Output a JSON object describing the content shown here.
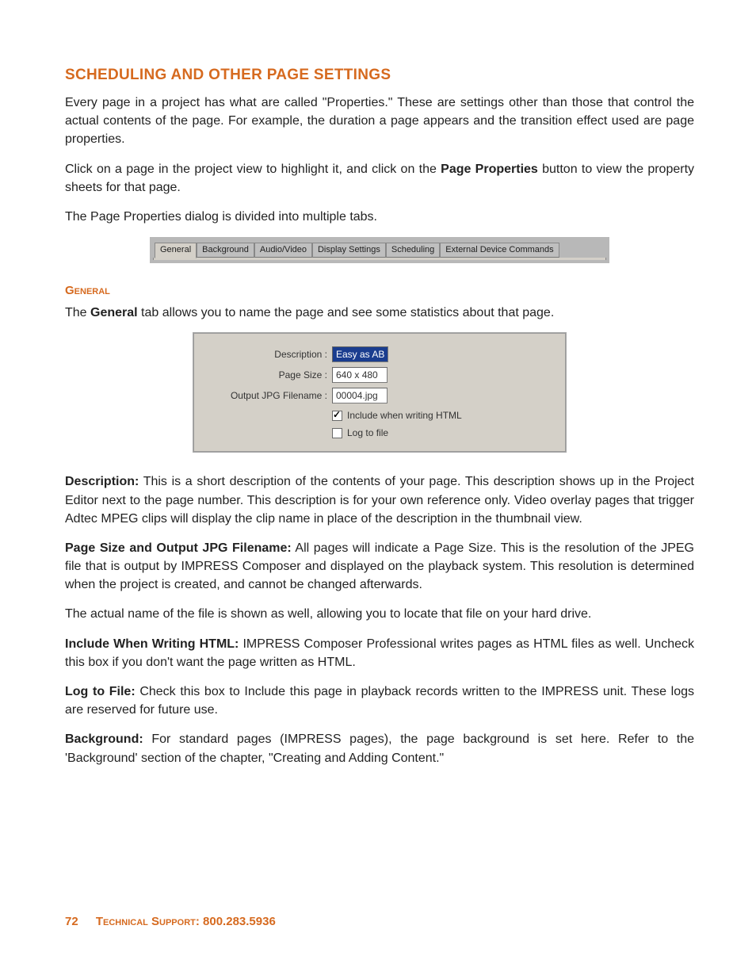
{
  "title": "SCHEDULING AND OTHER PAGE SETTINGS",
  "intro1_a": "Every page in a project has what are called \"Properties.\" These are settings other than those that control the actual contents of the page. For example, the duration a page appears and the transition effect used are page properties.",
  "intro2_a": "Click on a page in the project view to highlight it, and click on the ",
  "intro2_b": "Page Properties",
  "intro2_c": " button to view the property sheets for that page.",
  "intro3": "The Page Properties dialog is divided into multiple tabs.",
  "tabs": {
    "items": [
      {
        "label": "General",
        "active": true
      },
      {
        "label": "Background",
        "active": false
      },
      {
        "label": "Audio/Video",
        "active": false
      },
      {
        "label": "Display Settings",
        "active": false
      },
      {
        "label": "Scheduling",
        "active": false
      },
      {
        "label": "External Device Commands",
        "active": false
      }
    ]
  },
  "sub_general": "General",
  "general_intro_a": "The ",
  "general_intro_b": "General",
  "general_intro_c": " tab allows you to name the page and see some statistics about that page.",
  "panel": {
    "description_label": "Description :",
    "description_value": "Easy as AB",
    "pagesize_label": "Page Size :",
    "pagesize_value": "640 x 480",
    "jpg_label": "Output JPG Filename :",
    "jpg_value": "00004.jpg",
    "chk1_label": "Include when writing HTML",
    "chk1_checked": true,
    "chk2_label": "Log to file",
    "chk2_checked": false
  },
  "defs": {
    "description_h": "Description:",
    "description_t": " This is a short description of the contents of your page. This description shows up in the Project Editor next to the page number. This description is for your own reference only. Video overlay pages that trigger Adtec MPEG clips will display the clip name in place of the description in the thumbnail view.",
    "pagesize_h": "Page Size and Output JPG Filename:",
    "pagesize_t": " All pages will indicate a Page Size. This is the resolution of the JPEG file that is output by IMPRESS Composer and displayed on the playback system. This resolution is determined when the project is created, and cannot be changed afterwards.",
    "actualname": "The actual name of the file is shown as well, allowing you to locate that file on your hard drive.",
    "includehtml_h": "Include When Writing HTML:",
    "includehtml_t": " IMPRESS Composer Professional writes pages as HTML files as well. Uncheck this box if you don't want the page written as HTML.",
    "logfile_h": "Log to File:",
    "logfile_t": " Check this box to Include this page in playback records written to the IMPRESS unit. These logs are reserved for future use.",
    "background_h": "Background:",
    "background_t": " For standard pages (IMPRESS pages), the page background is set here. Refer to the 'Background' section of the chapter, \"Creating and Adding Content.\""
  },
  "footer": {
    "page": "72",
    "label": "Technical Support: ",
    "phone": "800.283.5936"
  }
}
